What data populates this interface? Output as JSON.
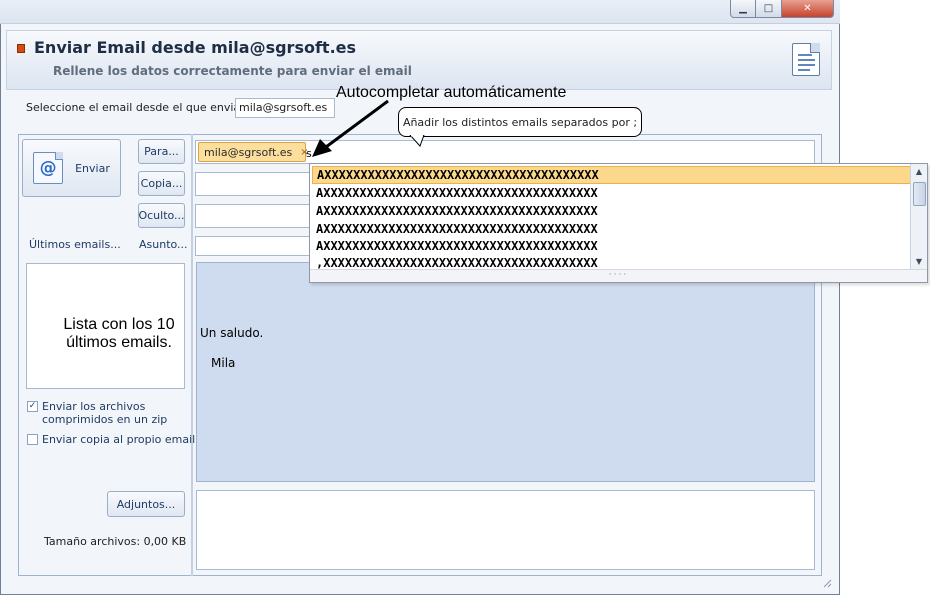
{
  "window": {
    "title": "Enviar Email desde mila@sgrsoft.es",
    "subtitle": "Rellene los datos correctamente para enviar el email",
    "controls": {
      "minimize": "▁",
      "maximize": "□",
      "close": "✕"
    }
  },
  "from": {
    "label": "Seleccione el email desde el que enviar",
    "value": "mila@sgrsoft.es"
  },
  "left_panel": {
    "send_label": "Enviar",
    "send_icon": "@",
    "to_label": "Para...",
    "cc_label": "Copia...",
    "bcc_label": "Oculto...",
    "recent_label": "Últimos emails...",
    "subject_label": "Asunto...",
    "zip_option": "Enviar los archivos comprimidos en un zip",
    "zip_checked": "✓",
    "copy_self_option": "Enviar copia al propio email",
    "attachments_label": "Adjuntos...",
    "size_label": "Tamaño archivos: 0,00 KB"
  },
  "to_field": {
    "token": "mila@sgrsoft.es",
    "token_remove": "×",
    "typed": "s"
  },
  "autocomplete": {
    "items": [
      "AXXXXXXXXXXXXXXXXXXXXXXXXXXXXXXXXXXXXXX",
      "AXXXXXXXXXXXXXXXXXXXXXXXXXXXXXXXXXXXXXX",
      "AXXXXXXXXXXXXXXXXXXXXXXXXXXXXXXXXXXXXXX",
      "AXXXXXXXXXXXXXXXXXXXXXXXXXXXXXXXXXXXXXX",
      "AXXXXXXXXXXXXXXXXXXXXXXXXXXXXXXXXXXXXXX",
      ",XXXXXXXXXXXXXXXXXXXXXXXXXXXXXXXXXXXXXX"
    ],
    "scroll_up": "▲",
    "scroll_down": "▼",
    "grip": "····"
  },
  "body": {
    "line1": "Un saludo.",
    "line2": "Mila"
  },
  "annotations": {
    "autocomplete": "Autocompletar automáticamente",
    "callout": "Añadir los distintos emails separados por ;",
    "recent_list_line1": "Lista con los 10",
    "recent_list_line2": "últimos emails."
  },
  "colors": {
    "accent_orange": "#fbd88c",
    "body_blue": "#cfdcef",
    "header_icon": "#d34b11"
  }
}
